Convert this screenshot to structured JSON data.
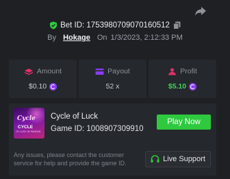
{
  "colors": {
    "background": "#1e2024",
    "card": "#25282d",
    "accent_green": "#2ec93f",
    "profit_green": "#43d35a",
    "coin_purple": "#8a3cf5",
    "amount_pink": "#e0306a",
    "verified_green": "#2ecc40"
  },
  "bet": {
    "id_label": "Bet ID: 1753980709070160512",
    "by_label": "By",
    "user": "Hokage",
    "on_label": "On",
    "datetime": "1/3/2023, 2:12:33 PM"
  },
  "stats": [
    {
      "label": "Amount",
      "value": "$0.10",
      "icon": "amount-icon",
      "coin": true
    },
    {
      "label": "Payout",
      "value": "52 x",
      "icon": "payout-icon",
      "coin": false
    },
    {
      "label": "Profit",
      "value": "$5.10",
      "icon": "profit-icon",
      "coin": true
    }
  ],
  "game": {
    "thumb_title": "Cycle",
    "thumb_subtitle": "CYCLE",
    "thumb_tagline": "OF LUCK IN PANDAS",
    "name": "Cycle of Luck",
    "id_label": "Game ID: 1008907309910",
    "play_label": "Play Now",
    "issue_text": "Any issues, please contact the customer service for help and provide the game ID.",
    "support_label": "Live Support"
  }
}
